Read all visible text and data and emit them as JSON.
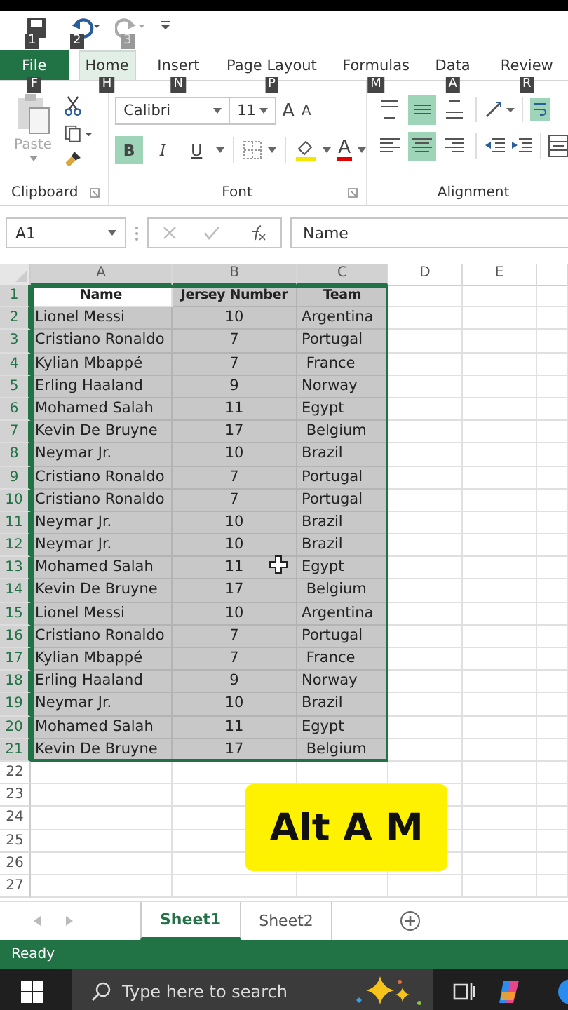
{
  "quick_access": [
    {
      "kind": "save",
      "key_tip": "1"
    },
    {
      "kind": "undo",
      "key_tip": "2"
    },
    {
      "kind": "redo",
      "key_tip": "3"
    }
  ],
  "ribbon_tabs": [
    {
      "label": "File",
      "key_tip": "F",
      "selected": false,
      "kind": "file"
    },
    {
      "label": "Home",
      "key_tip": "H",
      "selected": true,
      "kind": "tab"
    },
    {
      "label": "Insert",
      "key_tip": "N",
      "selected": false,
      "kind": "tab"
    },
    {
      "label": "Page Layout",
      "key_tip": "P",
      "selected": false,
      "kind": "tab"
    },
    {
      "label": "Formulas",
      "key_tip": "M",
      "selected": false,
      "kind": "tab"
    },
    {
      "label": "Data",
      "key_tip": "A",
      "selected": false,
      "kind": "tab"
    },
    {
      "label": "Review",
      "key_tip": "R",
      "selected": false,
      "kind": "tab"
    }
  ],
  "ribbon": {
    "paste": "Paste",
    "font_name": "Calibri",
    "font_size": "11",
    "grow_font": "A",
    "shrink_font": "A",
    "bold": "B",
    "bold_on": true,
    "italic": "I",
    "underline": "U",
    "font_color": "A",
    "align_buttons": [
      {
        "kind": "top",
        "on": false
      },
      {
        "kind": "middle",
        "on": true
      },
      {
        "kind": "bottom",
        "on": false
      },
      {
        "kind": "left",
        "on": false
      },
      {
        "kind": "center",
        "on": true
      },
      {
        "kind": "right",
        "on": false
      }
    ],
    "groups": [
      "Clipboard",
      "Font",
      "Alignment"
    ]
  },
  "formula_bar": {
    "name_box": "A1",
    "content": "Name"
  },
  "sheet": {
    "columns": [
      {
        "label": "A",
        "selected": true
      },
      {
        "label": "B",
        "selected": true
      },
      {
        "label": "C",
        "selected": true
      },
      {
        "label": "D",
        "selected": false
      },
      {
        "label": "E",
        "selected": false
      }
    ],
    "rows": [
      {
        "number": "1",
        "kind": "header",
        "selected": true,
        "cursor_in_first_cell": true,
        "cells": [
          "Name",
          "Jersey Number",
          "Team"
        ]
      },
      {
        "number": "2",
        "selected": true,
        "cells": [
          "Lionel Messi",
          "10",
          "Argentina"
        ]
      },
      {
        "number": "3",
        "selected": true,
        "cells": [
          "Cristiano Ronaldo",
          "7",
          "Portugal"
        ]
      },
      {
        "number": "4",
        "selected": true,
        "cells": [
          "Kylian Mbappé",
          "7",
          " France"
        ]
      },
      {
        "number": "5",
        "selected": true,
        "cells": [
          "Erling Haaland",
          "9",
          "Norway"
        ]
      },
      {
        "number": "6",
        "selected": true,
        "cells": [
          "Mohamed Salah",
          "11",
          "Egypt"
        ]
      },
      {
        "number": "7",
        "selected": true,
        "cells": [
          "Kevin De Bruyne",
          "17",
          " Belgium"
        ]
      },
      {
        "number": "8",
        "selected": true,
        "cells": [
          "Neymar Jr.",
          "10",
          "Brazil"
        ]
      },
      {
        "number": "9",
        "selected": true,
        "cells": [
          "Cristiano Ronaldo",
          "7",
          "Portugal"
        ]
      },
      {
        "number": "10",
        "selected": true,
        "cells": [
          "Cristiano Ronaldo",
          "7",
          "Portugal"
        ]
      },
      {
        "number": "11",
        "selected": true,
        "cells": [
          "Neymar Jr.",
          "10",
          "Brazil"
        ]
      },
      {
        "number": "12",
        "selected": true,
        "cells": [
          "Neymar Jr.",
          "10",
          "Brazil"
        ]
      },
      {
        "number": "13",
        "selected": true,
        "cells": [
          "Mohamed Salah",
          "11",
          "Egypt"
        ]
      },
      {
        "number": "14",
        "selected": true,
        "cells": [
          "Kevin De Bruyne",
          "17",
          " Belgium"
        ]
      },
      {
        "number": "15",
        "selected": true,
        "cells": [
          "Lionel Messi",
          "10",
          "Argentina"
        ]
      },
      {
        "number": "16",
        "selected": true,
        "cells": [
          "Cristiano Ronaldo",
          "7",
          "Portugal"
        ]
      },
      {
        "number": "17",
        "selected": true,
        "cells": [
          "Kylian Mbappé",
          "7",
          " France"
        ]
      },
      {
        "number": "18",
        "selected": true,
        "cells": [
          "Erling Haaland",
          "9",
          "Norway"
        ]
      },
      {
        "number": "19",
        "selected": true,
        "cells": [
          "Neymar Jr.",
          "10",
          "Brazil"
        ]
      },
      {
        "number": "20",
        "selected": true,
        "cells": [
          "Mohamed Salah",
          "11",
          "Egypt"
        ]
      },
      {
        "number": "21",
        "selected": true,
        "cells": [
          "Kevin De Bruyne",
          "17",
          " Belgium"
        ]
      },
      {
        "number": "22",
        "selected": false,
        "cells": []
      },
      {
        "number": "23",
        "selected": false,
        "cells": []
      },
      {
        "number": "24",
        "selected": false,
        "cells": []
      },
      {
        "number": "25",
        "selected": false,
        "cells": []
      },
      {
        "number": "26",
        "selected": false,
        "cells": []
      },
      {
        "number": "27",
        "selected": false,
        "cells": []
      }
    ]
  },
  "shortcut_caption": "Alt A M",
  "sheet_tabs": [
    {
      "label": "Sheet1",
      "selected": true
    },
    {
      "label": "Sheet2",
      "selected": false
    }
  ],
  "status_bar": "Ready",
  "taskbar": {
    "search_placeholder": "Type here to search"
  }
}
